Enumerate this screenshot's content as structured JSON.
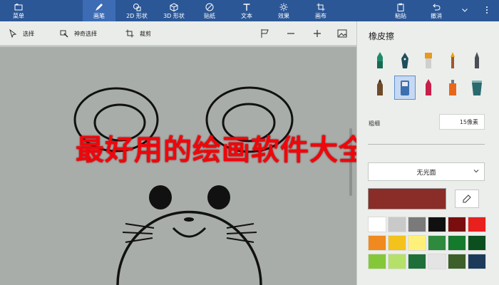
{
  "ribbon": {
    "menu_label": "菜单",
    "tabs": [
      {
        "label": "画笔",
        "icon": "brush-icon"
      },
      {
        "label": "2D 形状",
        "icon": "shapes-2d-icon"
      },
      {
        "label": "3D 形状",
        "icon": "cube-icon"
      },
      {
        "label": "贴纸",
        "icon": "sticker-icon"
      },
      {
        "label": "文本",
        "icon": "text-icon"
      },
      {
        "label": "效果",
        "icon": "sun-icon"
      },
      {
        "label": "画布",
        "icon": "canvas-crop-icon"
      }
    ],
    "paste_label": "粘贴",
    "undo_label": "撤消",
    "accent_color": "#2b5797"
  },
  "toolbar": {
    "select_label": "选择",
    "magic_select_label": "神奇选择",
    "crop_label": "裁剪"
  },
  "overlay": {
    "title": "最好用的绘画软件大全",
    "color": "#f0060b"
  },
  "panel": {
    "title": "橡皮擦",
    "thickness_label": "粗细",
    "thickness_value": "15像素",
    "finish_value": "无光面",
    "current_color": "#8a2c27",
    "brushes": [
      "marker-icon",
      "calligraphy-pen-icon",
      "oil-brush-icon",
      "watercolor-icon",
      "pixel-pen-icon",
      "pencil-icon",
      "eraser-icon",
      "crayon-icon",
      "spray-can-icon",
      "fill-bucket-icon"
    ],
    "swatches": [
      "#ffffff",
      "#c9c9c9",
      "#7a7a7a",
      "#101010",
      "#7a0e0e",
      "#e8201e",
      "#f08a1e",
      "#f3c21b",
      "#fff07a",
      "#2e8b3e",
      "#147a2c",
      "#0b4f1e",
      "#84c83a",
      "#b5e06a",
      "#1e6f3a",
      "#e4e4e4",
      "#3d5f2a",
      "#1c3b5a"
    ]
  }
}
